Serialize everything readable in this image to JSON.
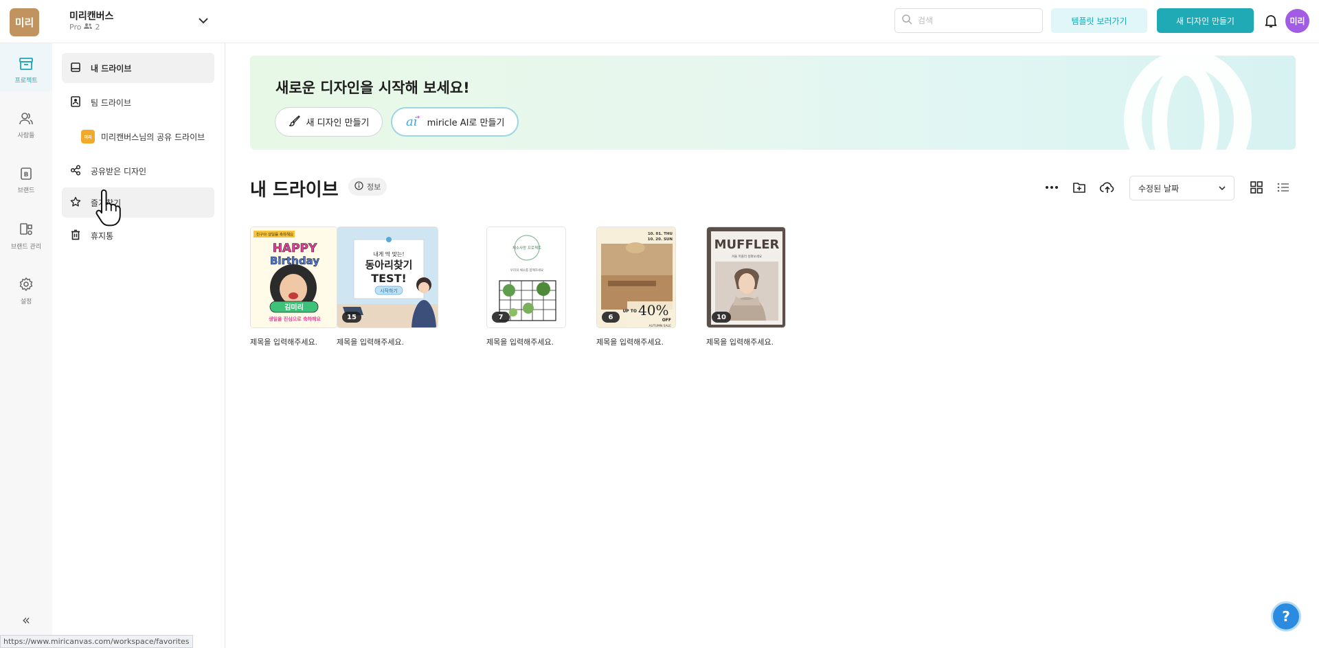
{
  "workspace": {
    "logo_text": "미리",
    "name": "미리캔버스",
    "plan": "Pro",
    "members": "2"
  },
  "header": {
    "search_placeholder": "검색",
    "template_button": "템플릿 보러가기",
    "new_design_button": "새 디자인 만들기",
    "avatar_text": "미리"
  },
  "rail": {
    "items": [
      {
        "label": "프로젝트",
        "icon": "folder-icon"
      },
      {
        "label": "사람들",
        "icon": "people-icon"
      },
      {
        "label": "브랜드",
        "icon": "brand-icon"
      },
      {
        "label": "브랜드 관리",
        "icon": "brand-manage-icon"
      },
      {
        "label": "설정",
        "icon": "gear-icon"
      }
    ],
    "collapse": "«"
  },
  "sidebar": {
    "my_drive": "내 드라이브",
    "team_drive": "팀 드라이브",
    "shared_drive_badge": "미리",
    "shared_drive": "미리캔버스님의 공유 드라이브",
    "shared_designs": "공유받은 디자인",
    "favorites": "즐겨찾기",
    "trash": "휴지통"
  },
  "status_url": "https://www.miricanvas.com/workspace/favorites",
  "banner": {
    "title": "새로운 디자인을 시작해 보세요!",
    "button_new": "새 디자인 만들기",
    "button_ai": "miricle AI로 만들기"
  },
  "drive": {
    "title": "내 드라이브",
    "info": "정보",
    "sort_value": "수정된 날짜"
  },
  "designs": [
    {
      "title": "제목을 입력해주세요.",
      "pages": "",
      "theme": "birthday",
      "thumb_text": {
        "top": "친구야 생일을 축하해요",
        "happy": "HAPPY",
        "birthday": "Birthday",
        "name": "김미리",
        "bottom": "생일을 진심으로 축하해요"
      }
    },
    {
      "title": "제목을 입력해주세요.",
      "pages": "15",
      "theme": "club",
      "thumb_text": {
        "small": "내게 딱 맞는!",
        "main": "동아리찾기",
        "test": "TEST!",
        "btn": "시작하기"
      }
    },
    {
      "title": "제목을 입력해주세요.",
      "pages": "7",
      "theme": "plant",
      "thumb_text": {
        "circle": "채소사랑 프로젝트",
        "desc": "우리의 채소를 함께하세요"
      }
    },
    {
      "title": "제목을 입력해주세요.",
      "pages": "6",
      "theme": "sale",
      "thumb_text": {
        "date1": "10. 01. THU",
        "date2": "10. 20. SUN",
        "up": "UP TO",
        "pct": "40%",
        "off": "OFF",
        "tag": "AUTUMN SALE"
      }
    },
    {
      "title": "제목을 입력해주세요.",
      "pages": "10",
      "theme": "muffler",
      "thumb_text": {
        "headline": "MUFFLER",
        "sub": "겨울 머플러 살펴보세요"
      }
    }
  ],
  "help_label": "?",
  "colors": {
    "accent": "#1faab5",
    "accent_light": "#e1f6f8",
    "avatar": "#a25ce4",
    "logo": "#c0935f"
  }
}
